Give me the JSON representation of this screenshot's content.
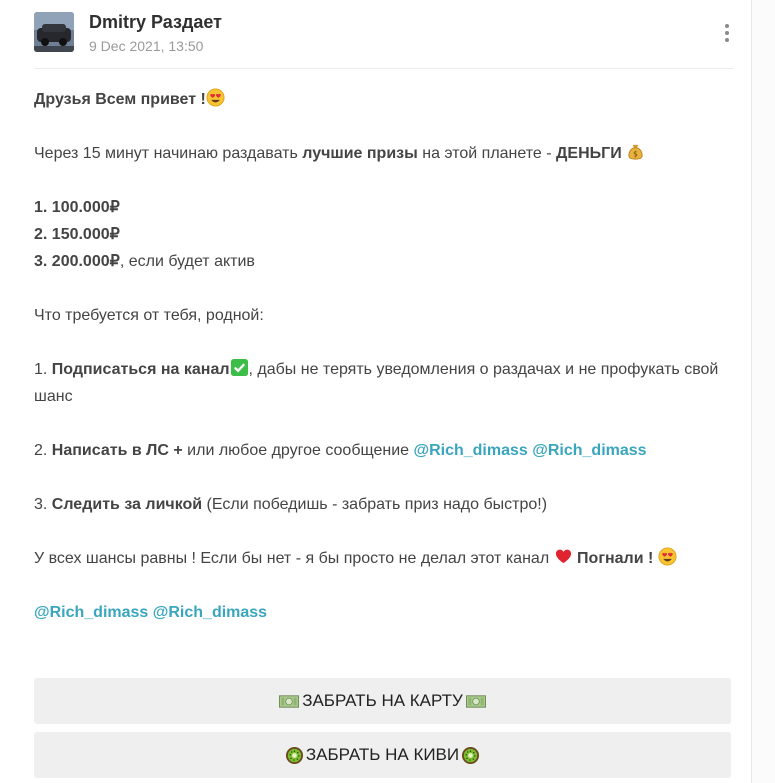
{
  "post": {
    "author": "Dmitry Раздает",
    "date": "9 Dec 2021, 13:50"
  },
  "message": {
    "greeting": "Друзья Всем привет !",
    "intro_pre": "Через 15 минут начинаю раздавать ",
    "intro_bold": "лучшие призы",
    "intro_mid": " на этой планете - ",
    "intro_money": "ДЕНЬГИ",
    "prize1": "1. 100.000₽",
    "prize2": "2. 150.000₽",
    "prize3": "3. 200.000₽",
    "prize3_suffix": ", если будет актив",
    "requirements": "Что требуется от тебя, родной:",
    "step1_num": "1. ",
    "step1_bold": "Подписаться на канал",
    "step1_rest": ", дабы не терять уведомления о раздачах и не профукать свой шанс",
    "step2_num": "2. ",
    "step2_bold": "Написать в ЛС +",
    "step2_rest": " или любое другое сообщение ",
    "step3_num": "3. ",
    "step3_bold": "Следить за личкой",
    "step3_rest": " (Если победишь - забрать приз надо быстро!)",
    "closing": "У всех шансы равны ! Если бы нет - я бы просто не делал этот канал ",
    "closing_bold": "Погнали !",
    "link1": "@Rich_dimass",
    "link2": "@Rich_dimass",
    "link3": "@Rich_dimass",
    "link4": "@Rich_dimass"
  },
  "buttons": {
    "card": "ЗАБРАТЬ НА КАРТУ",
    "qiwi": "ЗАБРАТЬ НА КИВИ"
  },
  "icons": {
    "heart_eyes": "heart-eyes-emoji-icon",
    "money_bag": "money-bag-emoji-icon",
    "check": "check-mark-emoji-icon",
    "heart": "red-heart-emoji-icon",
    "banknote": "dollar-banknote-emoji-icon",
    "kiwi": "kiwi-fruit-emoji-icon"
  },
  "colors": {
    "link": "#3aa6be",
    "button_bg": "#efefef",
    "text": "#444444"
  }
}
